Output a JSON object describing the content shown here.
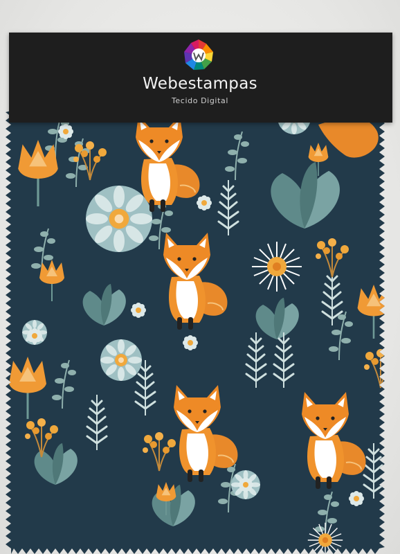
{
  "header": {
    "brand_name": "Webestampas",
    "subtitle": "Tecido Digital",
    "logo_icon": "webestampas-logo-icon"
  },
  "fabric": {
    "pattern": "fox-woodland-floral",
    "background_color": "#223a4a",
    "accent_colors": [
      "#e8892a",
      "#f4b04a",
      "#8fb3b6",
      "#ffffff",
      "#2a2a2a"
    ]
  }
}
